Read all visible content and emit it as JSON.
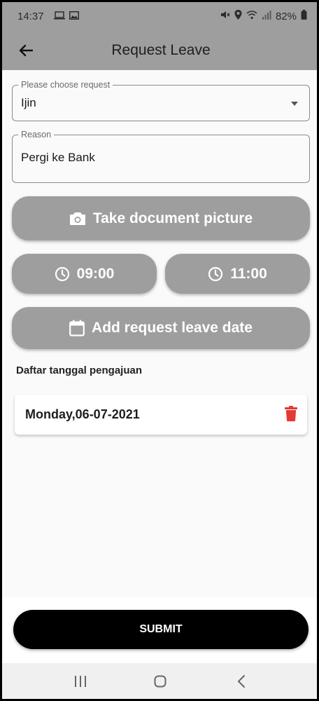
{
  "status_bar": {
    "time": "14:37",
    "battery": "82%",
    "icons_left": [
      "laptop-icon",
      "image-icon"
    ],
    "icons_right": [
      "mute-icon",
      "location-icon",
      "wifi-icon",
      "signal-icon",
      "battery-icon"
    ]
  },
  "app_bar": {
    "title": "Request Leave",
    "back_icon": "arrow-left-icon"
  },
  "form": {
    "request_type": {
      "label": "Please choose request",
      "value": "Ijin"
    },
    "reason": {
      "label": "Reason",
      "value": "Pergi ke Bank"
    },
    "take_picture_label": "Take document picture",
    "start_time": "09:00",
    "end_time": "11:00",
    "add_date_label": "Add request leave date"
  },
  "dates_section": {
    "title": "Daftar tanggal pengajuan",
    "items": [
      {
        "date": "Monday,06-07-2021"
      }
    ]
  },
  "submit_label": "SUBMIT",
  "colors": {
    "app_bar": "#9e9e9e",
    "button_gray": "#9e9e9e",
    "submit_bg": "#000000",
    "delete": "#e53935"
  }
}
